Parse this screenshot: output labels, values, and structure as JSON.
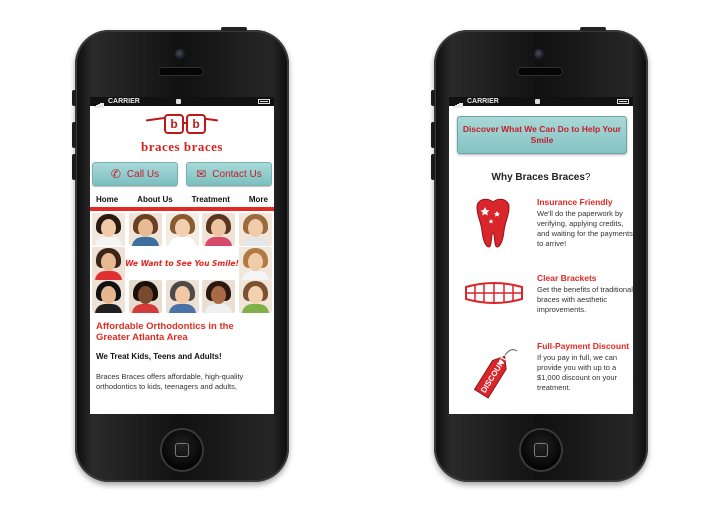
{
  "status_bar": {
    "carrier": "CARRIER"
  },
  "left_screen": {
    "logo_text": "braces braces",
    "logo_badge_letter_1": "b",
    "logo_badge_letter_2": "b",
    "call_us": "Call Us",
    "contact_us": "Contact Us",
    "nav": [
      "Home",
      "About Us",
      "Treatment",
      "More"
    ],
    "banner": "We Want to See You Smile!",
    "heading": "Affordable Orthodontics in the Greater Atlanta Area",
    "subheading": "We Treat Kids, Teens and Adults!",
    "paragraph": "Braces Braces offers affordable, high-quality orthodontics to kids, teenagers and adults,"
  },
  "right_screen": {
    "discover_button": "Discover What We Can Do to Help Your Smile",
    "why_title": "Why Braces Braces",
    "why_q": "?",
    "features": [
      {
        "title": "Insurance Friendly",
        "desc": "We'll do the paperwork by verifying, applying credits, and waiting for the payments to arrive!",
        "icon": "tooth-icon"
      },
      {
        "title": "Clear Brackets",
        "desc": "Get the benefits of traditional braces with aesthetic improvements.",
        "icon": "braces-icon"
      },
      {
        "title": "Full-Payment Discount",
        "desc": "If you pay in full, we can provide you with up to a $1,000 discount on your treatment.",
        "icon": "discount-tag-icon",
        "tag_text": "DISCOUNT"
      }
    ]
  },
  "colors": {
    "brand_red": "#e02622",
    "teal_button": "#8cc8c8"
  }
}
